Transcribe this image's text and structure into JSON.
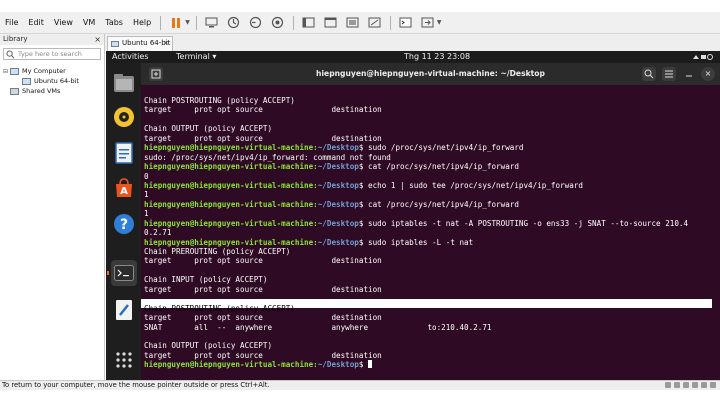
{
  "menubar": {
    "items": [
      "File",
      "Edit",
      "View",
      "VM",
      "Tabs",
      "Help"
    ]
  },
  "library": {
    "title": "Library",
    "close": "×",
    "search_placeholder": "Type here to search",
    "tree": [
      {
        "label": "My Computer",
        "level": 0
      },
      {
        "label": "Ubuntu 64-bit",
        "level": 1
      },
      {
        "label": "Shared VMs",
        "level": 0
      }
    ]
  },
  "tab": {
    "label": "Ubuntu 64-bit",
    "close": "×"
  },
  "guest": {
    "topbar": {
      "activities": "Activities",
      "app": "Terminal ▾",
      "clock": "Thg 11 23  23:08"
    },
    "terminal": {
      "title": "hiepnguyen@hiepnguyen-virtual-machine: ~/Desktop",
      "lines": [
        "Chain POSTROUTING (policy ACCEPT)",
        "target     prot opt source               destination",
        "",
        "Chain OUTPUT (policy ACCEPT)",
        "target     prot opt source               destination",
        {
          "user": "hiepnguyen@hiepnguyen-virtual-machine:",
          "path": "~/Desktop",
          "cmd": "$ sudo /proc/sys/net/ipv4/ip_forward"
        },
        "sudo: /proc/sys/net/ipv4/ip_forward: command not found",
        {
          "user": "hiepnguyen@hiepnguyen-virtual-machine:",
          "path": "~/Desktop",
          "cmd": "$ cat /proc/sys/net/ipv4/ip_forward"
        },
        "0",
        {
          "user": "hiepnguyen@hiepnguyen-virtual-machine:",
          "path": "~/Desktop",
          "cmd": "$ echo 1 | sudo tee /proc/sys/net/ipv4/ip_forward"
        },
        "1",
        {
          "user": "hiepnguyen@hiepnguyen-virtual-machine:",
          "path": "~/Desktop",
          "cmd": "$ cat /proc/sys/net/ipv4/ip_forward"
        },
        "1",
        {
          "user": "hiepnguyen@hiepnguyen-virtual-machine:",
          "path": "~/Desktop",
          "cmd": "$ sudo iptables -t nat -A POSTROUTING -o ens33 -j SNAT --to-source 210.4"
        },
        "0.2.71",
        {
          "user": "hiepnguyen@hiepnguyen-virtual-machine:",
          "path": "~/Desktop",
          "cmd": "$ sudo iptables -L -t nat"
        },
        "Chain PREROUTING (policy ACCEPT)",
        "target     prot opt source               destination",
        "",
        "Chain INPUT (policy ACCEPT)",
        "target     prot opt source               destination",
        "",
        "Chain POSTROUTING (policy ACCEPT)",
        "target     prot opt source               destination",
        "SNAT       all  --  anywhere             anywhere             to:210.40.2.71",
        "",
        "Chain OUTPUT (policy ACCEPT)",
        "target     prot opt source               destination",
        {
          "user": "hiepnguyen@hiepnguyen-virtual-machine:",
          "path": "~/Desktop",
          "cmd": "$ "
        }
      ]
    }
  },
  "statusbar": {
    "text": "To return to your computer, move the mouse pointer outside or press Ctrl+Alt."
  },
  "colors": {
    "terminal_bg": "#2f0a24",
    "prompt_user": "#8ae234",
    "prompt_path": "#729fcf",
    "pause_accent": "#e77817"
  },
  "icons": [
    "pause-icon",
    "send-ctrl-alt-del-icon",
    "snapshot-icon",
    "revert-snapshot-icon",
    "snapshot-manager-icon",
    "view-normal-icon",
    "view-unity-icon",
    "full-screen-icon",
    "console-icon",
    "stretch-icon"
  ]
}
